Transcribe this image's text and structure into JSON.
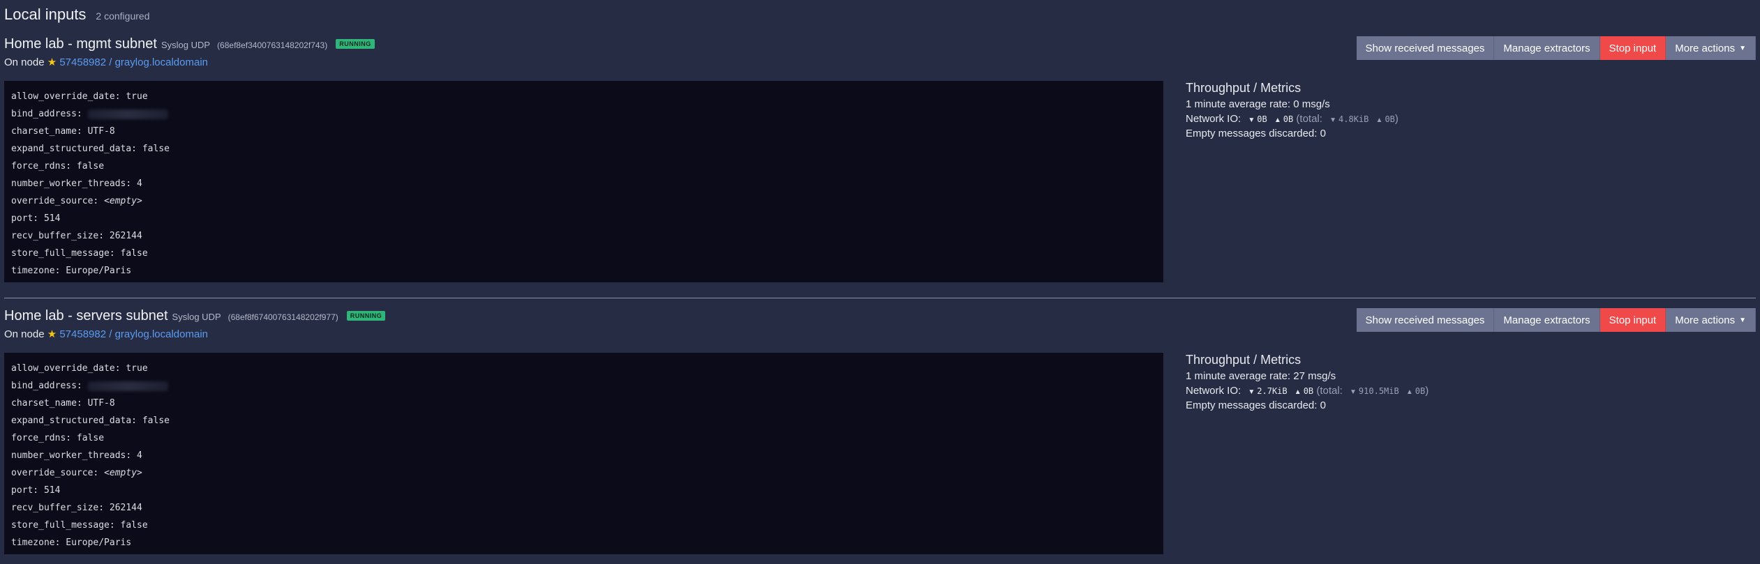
{
  "header": {
    "title": "Local inputs",
    "subtitle": "2 configured"
  },
  "actions": {
    "show": "Show received messages",
    "extractors": "Manage extractors",
    "stop": "Stop input",
    "more": "More actions"
  },
  "colors": {
    "running": "#2fb57a",
    "danger": "#f0494a",
    "button": "#6b7391",
    "link": "#5b9bf0"
  },
  "inputs": [
    {
      "name": "Home lab - mgmt subnet",
      "type": "Syslog UDP",
      "id": "(68ef8ef3400763148202f743)",
      "status": "RUNNING",
      "node_prefix": "On node",
      "node_link": "57458982 / graylog.localdomain",
      "config": [
        "allow_override_date: true",
        "bind_address:",
        "charset_name: UTF-8",
        "expand_structured_data: false",
        "force_rdns: false",
        "number_worker_threads: 4",
        "override_source:",
        "port: 514",
        "recv_buffer_size: 262144",
        "store_full_message: false",
        "timezone: Europe/Paris"
      ],
      "override_empty": "<empty>",
      "metrics": {
        "title": "Throughput / Metrics",
        "rate": "1 minute average rate: 0 msg/s",
        "net_label": "Network IO:",
        "in": "0B",
        "out": "0B",
        "total_label": "(total:",
        "total_in": "4.8KiB",
        "total_out": "0B",
        "close": ")",
        "discarded": "Empty messages discarded: 0"
      }
    },
    {
      "name": "Home lab - servers subnet",
      "type": "Syslog UDP",
      "id": "(68ef8f67400763148202f977)",
      "status": "RUNNING",
      "node_prefix": "On node",
      "node_link": "57458982 / graylog.localdomain",
      "config": [
        "allow_override_date: true",
        "bind_address:",
        "charset_name: UTF-8",
        "expand_structured_data: false",
        "force_rdns: false",
        "number_worker_threads: 4",
        "override_source:",
        "port: 514",
        "recv_buffer_size: 262144",
        "store_full_message: false",
        "timezone: Europe/Paris"
      ],
      "override_empty": "<empty>",
      "metrics": {
        "title": "Throughput / Metrics",
        "rate": "1 minute average rate: 27 msg/s",
        "net_label": "Network IO:",
        "in": "2.7KiB",
        "out": "0B",
        "total_label": "(total:",
        "total_in": "910.5MiB",
        "total_out": "0B",
        "close": ")",
        "discarded": "Empty messages discarded: 0"
      }
    }
  ]
}
